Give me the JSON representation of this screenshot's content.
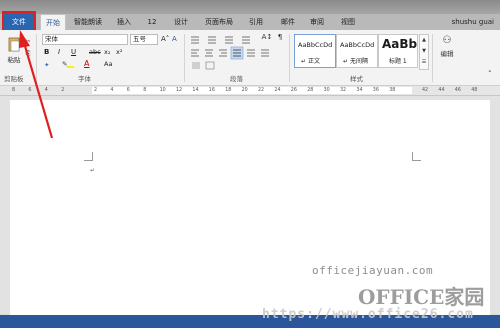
{
  "tabs": {
    "file": "文件",
    "home": "开始",
    "smart": "智能朗读",
    "insert": "插入",
    "num12": "12",
    "design": "设计",
    "layout": "页面布局",
    "references": "引用",
    "mailings": "邮件",
    "review": "审阅",
    "view": "视图"
  },
  "user_name": "shushu guai",
  "clipboard": {
    "paste_label": "粘贴",
    "group_label": "剪贴板"
  },
  "font": {
    "name": "宋体",
    "size": "五号",
    "bold": "B",
    "italic": "I",
    "underline": "U",
    "strike": "abc",
    "subscript": "x₂",
    "superscript": "x²",
    "font_color_glyph": "A",
    "case_glyph": "Aa",
    "group_label": "字体"
  },
  "paragraph": {
    "group_label": "段落"
  },
  "styles": {
    "items": [
      {
        "sample": "AaBbCcDd",
        "name": "正文"
      },
      {
        "sample": "AaBbCcDd",
        "name": "无间隔"
      },
      {
        "sample": "AaBb",
        "name": "标题 1"
      }
    ],
    "group_label": "样式"
  },
  "editing": {
    "label": "编辑"
  },
  "ruler_ticks": [
    "8",
    "6",
    "4",
    "2",
    "",
    "2",
    "4",
    "6",
    "8",
    "10",
    "12",
    "14",
    "16",
    "18",
    "20",
    "22",
    "24",
    "26",
    "28",
    "30",
    "32",
    "34",
    "36",
    "38",
    "",
    "42",
    "44",
    "46",
    "48"
  ],
  "watermark": {
    "site": "officejiayuan.com",
    "brand": "OFFICE家园",
    "url": "https://www.office26.com"
  },
  "colors": {
    "accent_blue": "#2b579a",
    "file_tab_blue": "#2a65b0",
    "highlight_red": "#e02020"
  }
}
